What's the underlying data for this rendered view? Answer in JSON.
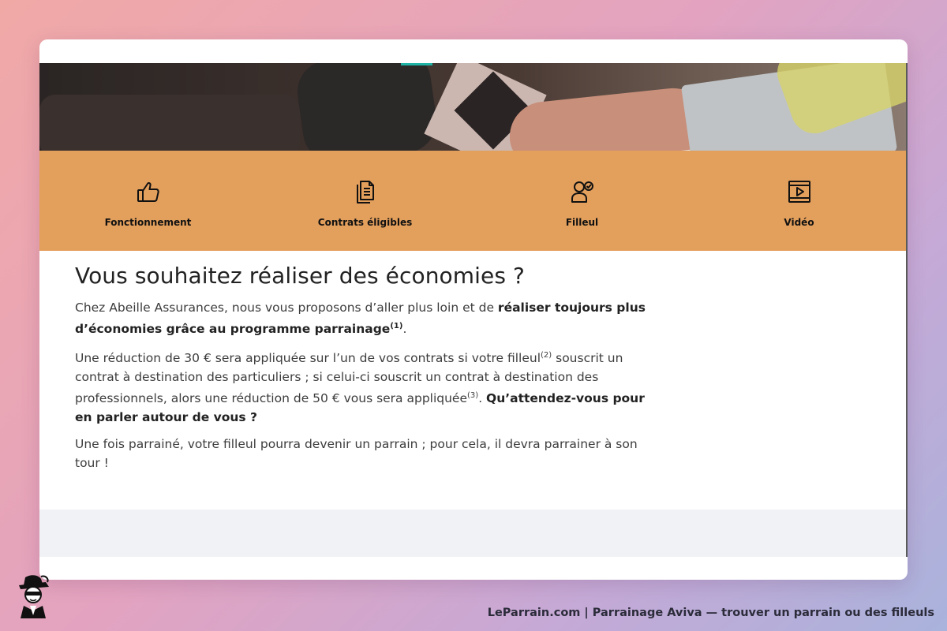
{
  "nav": {
    "items": [
      {
        "label": "Fonctionnement",
        "icon": "thumbs-up-icon"
      },
      {
        "label": "Contrats éligibles",
        "icon": "documents-icon"
      },
      {
        "label": "Filleul",
        "icon": "user-check-icon"
      },
      {
        "label": "Vidéo",
        "icon": "video-icon"
      }
    ]
  },
  "content": {
    "title": "Vous souhaitez réaliser des économies ?",
    "p1": {
      "text": "Chez Abeille Assurances, nous vous proposons d’aller plus loin et de ",
      "bold": "réaliser toujours plus d’économies grâce au programme parrainage",
      "sup": "(1)",
      "end": "."
    },
    "p2": {
      "t1": "Une réduction de 30 € sera appliquée sur l’un de vos contrats si votre filleul",
      "sup1": "(2)",
      "t2": " souscrit un contrat à destination des particuliers ; si celui-ci souscrit un contrat à destination des professionnels, alors une réduction de 50 € vous sera appliquée",
      "sup2": "(3)",
      "t3": ". ",
      "bold": "Qu’attendez-vous pour en parler autour de vous ?"
    },
    "p3": "Une fois parrainé, votre filleul pourra devenir un parrain ; pour cela, il devra parrainer à son tour !"
  },
  "footer": {
    "caption": "LeParrain.com | Parrainage Aviva — trouver un parrain ou des filleuls"
  },
  "colors": {
    "nav_bg": "#e39f5c",
    "background_start": "#f1a9a6",
    "background_end": "#a9b3dc"
  }
}
